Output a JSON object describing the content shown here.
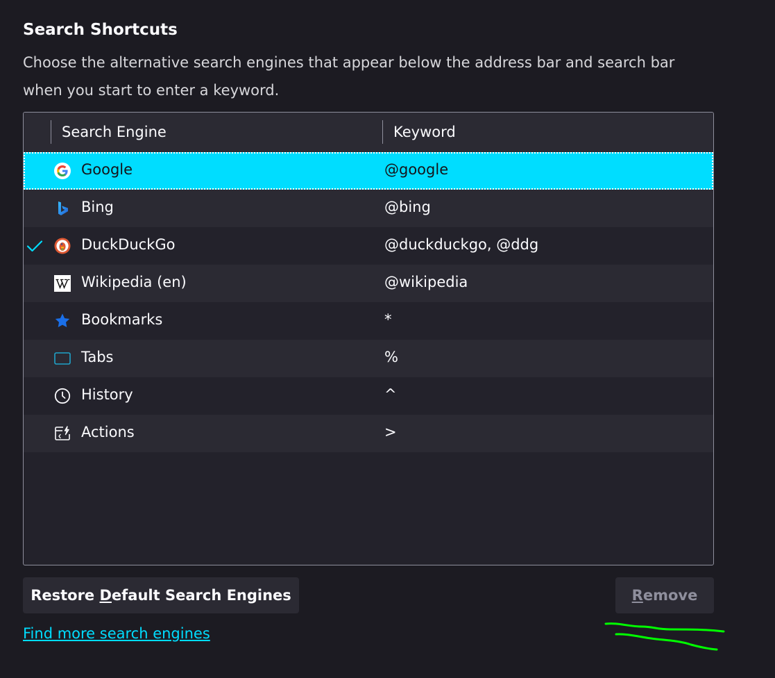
{
  "section": {
    "title": "Search Shortcuts",
    "description": "Choose the alternative search engines that appear below the address bar and search bar when you start to enter a keyword."
  },
  "table": {
    "columns": {
      "engine": "Search Engine",
      "keyword": "Keyword"
    },
    "rows": [
      {
        "name": "Google",
        "keyword": "@google",
        "icon": "google-icon",
        "checked": false,
        "selected": true
      },
      {
        "name": "Bing",
        "keyword": "@bing",
        "icon": "bing-icon",
        "checked": false,
        "selected": false
      },
      {
        "name": "DuckDuckGo",
        "keyword": "@duckduckgo, @ddg",
        "icon": "duckduckgo-icon",
        "checked": true,
        "selected": false
      },
      {
        "name": "Wikipedia (en)",
        "keyword": "@wikipedia",
        "icon": "wikipedia-icon",
        "checked": false,
        "selected": false
      },
      {
        "name": "Bookmarks",
        "keyword": "*",
        "icon": "star-icon",
        "checked": false,
        "selected": false
      },
      {
        "name": "Tabs",
        "keyword": "%",
        "icon": "tab-icon",
        "checked": false,
        "selected": false
      },
      {
        "name": "History",
        "keyword": "^",
        "icon": "clock-icon",
        "checked": false,
        "selected": false
      },
      {
        "name": "Actions",
        "keyword": ">",
        "icon": "actions-icon",
        "checked": false,
        "selected": false
      }
    ]
  },
  "buttons": {
    "restore_pre": "Restore ",
    "restore_accel": "D",
    "restore_post": "efault Search Engines",
    "remove_accel": "R",
    "remove_post": "emove"
  },
  "link": {
    "find_more": "Find more search engines"
  },
  "colors": {
    "background": "#1c1b22",
    "selected_row": "#00ddff",
    "link": "#00ddff",
    "annotation": "#00ff00"
  }
}
